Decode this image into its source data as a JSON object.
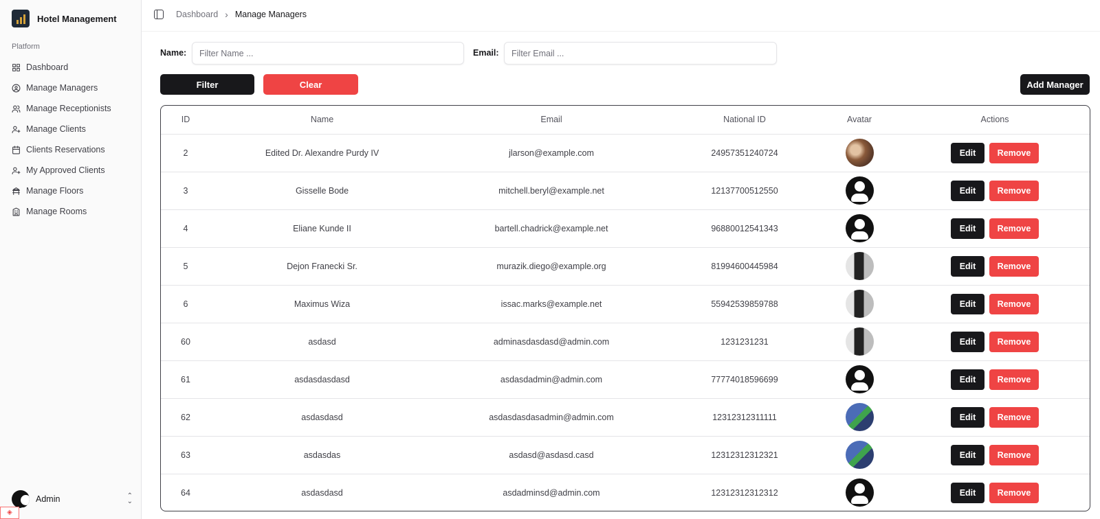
{
  "app": {
    "title": "Hotel Management"
  },
  "sidebar": {
    "group_label": "Platform",
    "items": [
      {
        "label": "Dashboard",
        "icon": "grid-icon"
      },
      {
        "label": "Manage Managers",
        "icon": "user-circle-icon"
      },
      {
        "label": "Manage Receptionists",
        "icon": "users-icon"
      },
      {
        "label": "Manage Clients",
        "icon": "user-plus-icon"
      },
      {
        "label": "Clients Reservations",
        "icon": "calendar-icon"
      },
      {
        "label": "My Approved Clients",
        "icon": "user-plus-icon"
      },
      {
        "label": "Manage Floors",
        "icon": "floors-icon"
      },
      {
        "label": "Manage Rooms",
        "icon": "building-icon"
      }
    ],
    "user": {
      "name": "Admin"
    }
  },
  "breadcrumb": {
    "parent": "Dashboard",
    "current": "Manage Managers"
  },
  "filters": {
    "name_label": "Name:",
    "name_placeholder": "Filter Name ...",
    "email_label": "Email:",
    "email_placeholder": "Filter Email ...",
    "filter_button": "Filter",
    "clear_button": "Clear",
    "add_button": "Add Manager"
  },
  "table": {
    "columns": [
      "ID",
      "Name",
      "Email",
      "National ID",
      "Avatar",
      "Actions"
    ],
    "edit_label": "Edit",
    "remove_label": "Remove",
    "rows": [
      {
        "id": "2",
        "name": "Edited Dr. Alexandre Purdy IV",
        "email": "jlarson@example.com",
        "national_id": "24957351240724",
        "avatar": "photo-brown"
      },
      {
        "id": "3",
        "name": "Gisselle Bode",
        "email": "mitchell.beryl@example.net",
        "national_id": "12137700512550",
        "avatar": "default"
      },
      {
        "id": "4",
        "name": "Eliane Kunde II",
        "email": "bartell.chadrick@example.net",
        "national_id": "96880012541343",
        "avatar": "default"
      },
      {
        "id": "5",
        "name": "Dejon Franecki Sr.",
        "email": "murazik.diego@example.org",
        "national_id": "81994600445984",
        "avatar": "photo-bw"
      },
      {
        "id": "6",
        "name": "Maximus Wiza",
        "email": "issac.marks@example.net",
        "national_id": "55942539859788",
        "avatar": "photo-bw"
      },
      {
        "id": "60",
        "name": "asdasd",
        "email": "adminasdasdasd@admin.com",
        "national_id": "1231231231",
        "avatar": "photo-bw"
      },
      {
        "id": "61",
        "name": "asdasdasdasd",
        "email": "asdasdadmin@admin.com",
        "national_id": "77774018596699",
        "avatar": "default"
      },
      {
        "id": "62",
        "name": "asdasdasd",
        "email": "asdasdasdasadmin@admin.com",
        "national_id": "12312312311111",
        "avatar": "photo-blue"
      },
      {
        "id": "63",
        "name": "asdasdas",
        "email": "asdasd@asdasd.casd",
        "national_id": "12312312312321",
        "avatar": "photo-blue"
      },
      {
        "id": "64",
        "name": "asdasdasd",
        "email": "asdadminsd@admin.com",
        "national_id": "12312312312312",
        "avatar": "default"
      }
    ]
  },
  "colors": {
    "primary": "#18181b",
    "danger": "#ef4444",
    "border": "#e4e4e7"
  }
}
